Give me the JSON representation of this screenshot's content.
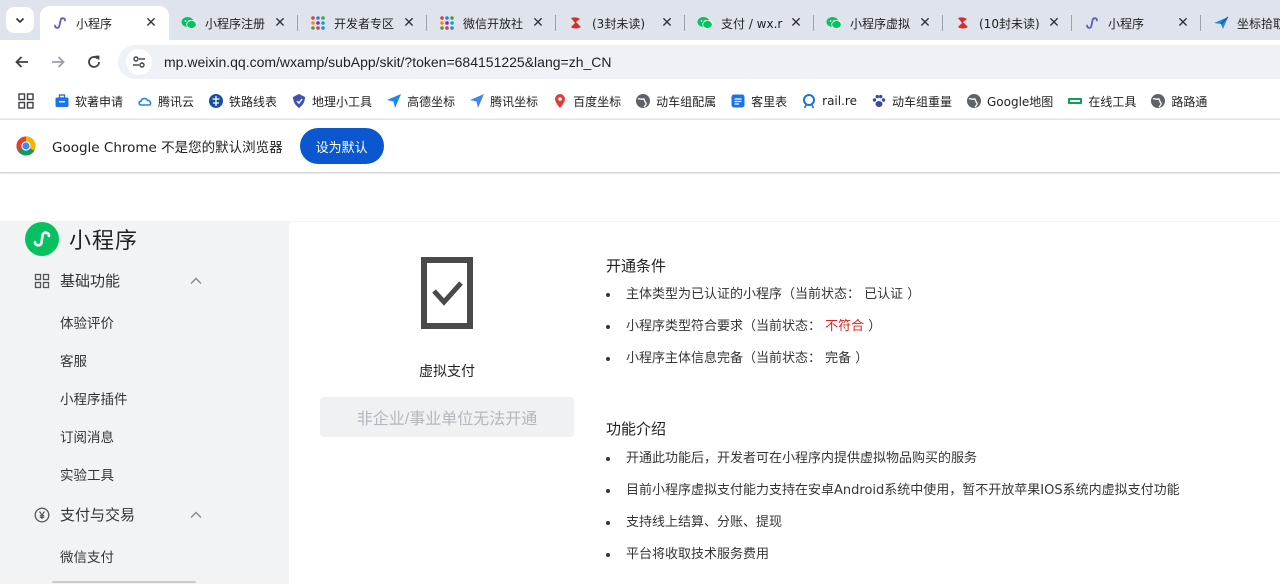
{
  "browser": {
    "tabs": [
      {
        "title": "小程序",
        "icon": "miniprogram-icon",
        "active": true
      },
      {
        "title": "小程序注册",
        "icon": "wechat-icon"
      },
      {
        "title": "开发者专区",
        "icon": "grid-dots-icon"
      },
      {
        "title": "微信开放社",
        "icon": "grid-dots-icon"
      },
      {
        "title": "(3封未读)",
        "icon": "mail-icon"
      },
      {
        "title": "支付 / wx.r",
        "icon": "wechat-icon"
      },
      {
        "title": "小程序虚拟",
        "icon": "wechat-icon"
      },
      {
        "title": "(10封未读)",
        "icon": "mail-icon"
      },
      {
        "title": "小程序",
        "icon": "miniprogram-icon"
      },
      {
        "title": "坐标拾取",
        "icon": "plane-icon"
      }
    ],
    "url": {
      "host": "mp.weixin.qq.com",
      "path": "/wxamp/subApp/skit/?token=684151225&lang=zh_CN"
    },
    "bookmarks": [
      {
        "label": "软著申请",
        "icon": "briefcase-icon",
        "color": "#1a73e8"
      },
      {
        "label": "腾讯云",
        "icon": "cloud-icon",
        "color": "#1e88e5"
      },
      {
        "label": "铁路线表",
        "icon": "rail-icon",
        "color": "#174ea6"
      },
      {
        "label": "地理小工具",
        "icon": "pin-shield-icon",
        "color": "#3f51b5"
      },
      {
        "label": "高德坐标",
        "icon": "arrow-map-icon",
        "color": "#1e88e5"
      },
      {
        "label": "腾讯坐标",
        "icon": "arrow-map-icon",
        "color": "#4285f4"
      },
      {
        "label": "百度坐标",
        "icon": "location-pin-icon",
        "color": "#e53935"
      },
      {
        "label": "动车组配属",
        "icon": "globe-icon",
        "color": "#5f6368"
      },
      {
        "label": "客里表",
        "icon": "doc-icon",
        "color": "#1a73e8"
      },
      {
        "label": "rail.re",
        "icon": "ring-icon",
        "color": "#1976d2"
      },
      {
        "label": "动车组重量",
        "icon": "paw-icon",
        "color": "#3949ab"
      },
      {
        "label": "Google地图",
        "icon": "globe-icon",
        "color": "#5f6368"
      },
      {
        "label": "在线工具",
        "icon": "bar-icon",
        "color": "#0f9d58"
      },
      {
        "label": "路路通",
        "icon": "globe-icon",
        "color": "#5f6368"
      }
    ],
    "infobar": {
      "text": "Google Chrome 不是您的默认浏览器",
      "button": "设为默认"
    }
  },
  "sidebar": {
    "brand": "小程序",
    "groups": [
      {
        "label": "基础功能",
        "icon": "grid-icon",
        "items": [
          "体验评价",
          "客服",
          "小程序插件",
          "订阅消息",
          "实验工具"
        ]
      },
      {
        "label": "支付与交易",
        "icon": "yen-icon",
        "items": [
          "微信支付"
        ]
      }
    ]
  },
  "feature": {
    "title": "虚拟支付",
    "button": "非企业/事业单位无法开通",
    "conditions_title": "开通条件",
    "conditions": [
      {
        "text": "主体类型为已认证的小程序（当前状态：",
        "status": " 已认证 ",
        "close": "）",
        "warn": false
      },
      {
        "text": "小程序类型符合要求（当前状态：",
        "status": " 不符合 ",
        "close": "）",
        "warn": true
      },
      {
        "text": "小程序主体信息完备（当前状态：",
        "status": " 完备 ",
        "close": "）",
        "warn": false
      }
    ],
    "intro_title": "功能介绍",
    "intro": [
      "开通此功能后，开发者可在小程序内提供虚拟物品购买的服务",
      "目前小程序虚拟支付能力支持在安卓Android系统中使用，暂不开放苹果IOS系统内虚拟支付功能",
      "支持线上结算、分账、提现",
      "平台将收取技术服务费用"
    ]
  },
  "colors": {
    "accent": "#07c160",
    "warn": "#e02020",
    "chrome_blue": "#0b57d0"
  }
}
